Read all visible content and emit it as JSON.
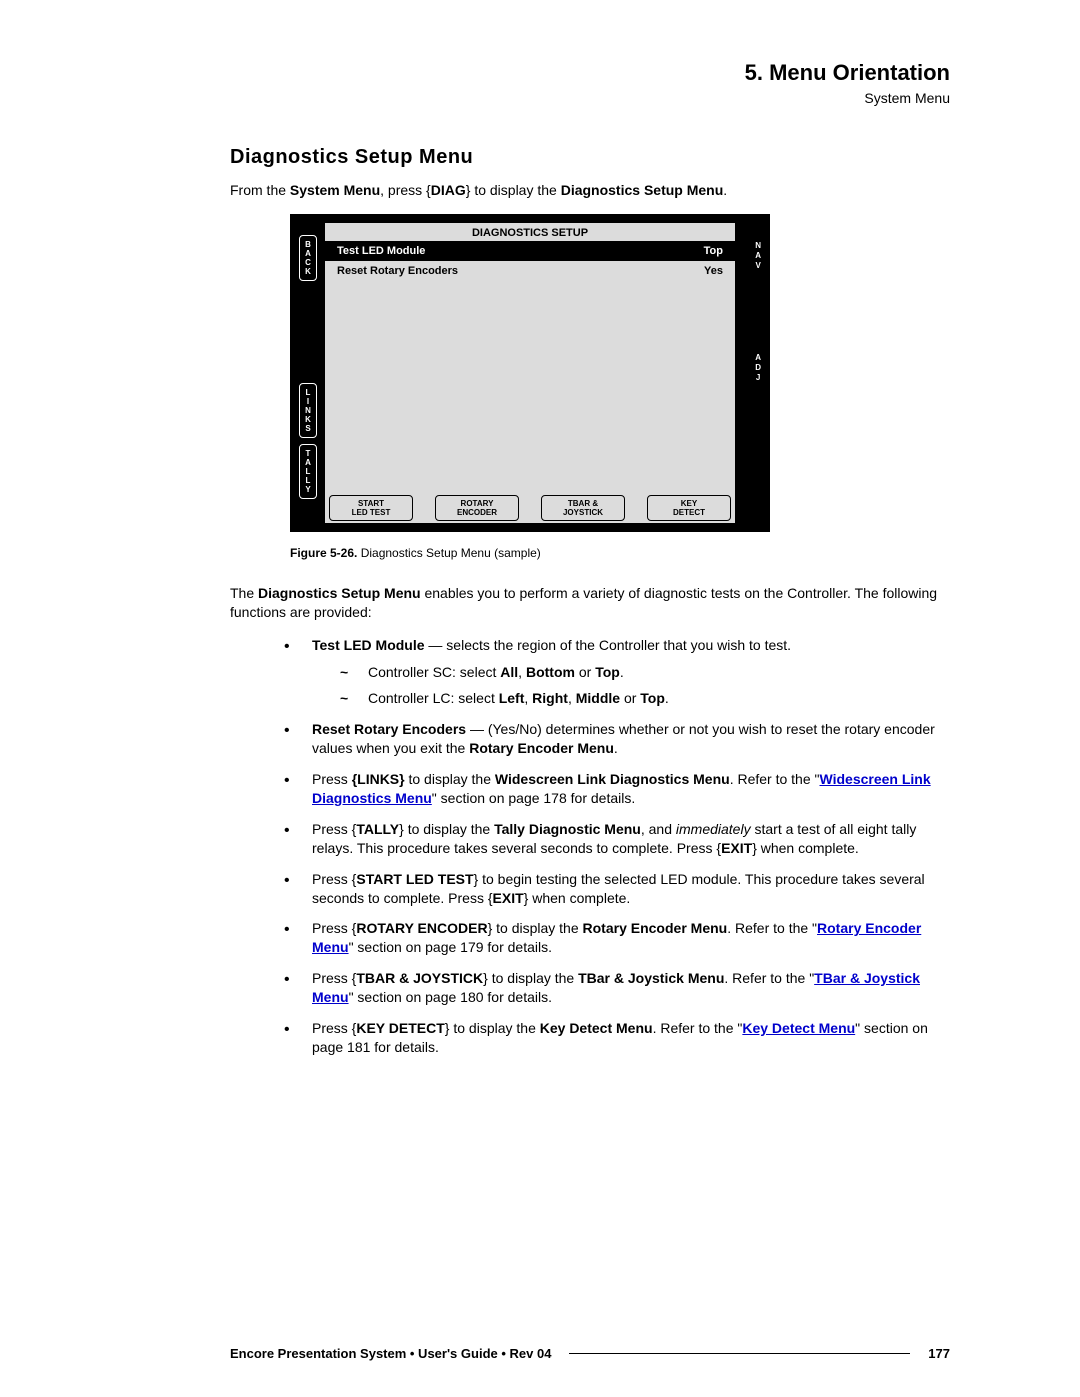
{
  "header": {
    "chapter": "5.  Menu Orientation",
    "crumb": "System Menu"
  },
  "section_title": "Diagnostics Setup Menu",
  "intro": {
    "p1": "From the ",
    "b1": "System Menu",
    "p2": ", press {",
    "b2": "DIAG",
    "p3": "} to display the ",
    "b3": "Diagnostics Setup Menu",
    "p4": "."
  },
  "device": {
    "title": "DIAGNOSTICS SETUP",
    "row1": {
      "label": "Test LED Module",
      "value": "Top"
    },
    "row2": {
      "label": "Reset Rotary Encoders",
      "value": "Yes"
    },
    "left": {
      "back": "BACK",
      "links": "LINKS",
      "tally": "TALLY"
    },
    "right": {
      "nav": "NAV",
      "adj": "ADJ"
    },
    "bottom": {
      "b1a": "START",
      "b1b": "LED TEST",
      "b2a": "ROTARY",
      "b2b": "ENCODER",
      "b3a": "TBAR &",
      "b3b": "JOYSTICK",
      "b4a": "KEY",
      "b4b": "DETECT"
    }
  },
  "figure": {
    "label_b": "Figure 5-26.",
    "label": "  Diagnostics Setup Menu  (sample)"
  },
  "desc": {
    "p1": "The ",
    "b1": "Diagnostics Setup Menu",
    "p2": " enables you to perform a variety of diagnostic tests on the Controller.  The following functions are provided:"
  },
  "bullets": {
    "b1": {
      "b": "Test LED Module",
      "t": " — selects the region of the Controller that you wish to test.",
      "s1a": "Controller SC:  select ",
      "s1b": "All",
      "s1c": ", ",
      "s1d": "Bottom",
      "s1e": " or ",
      "s1f": "Top",
      "s1g": ".",
      "s2a": "Controller LC:  select ",
      "s2b": "Left",
      "s2c": ", ",
      "s2d": "Right",
      "s2e": ", ",
      "s2f": "Middle",
      "s2g": " or ",
      "s2h": "Top",
      "s2i": "."
    },
    "b2": {
      "b": "Reset Rotary Encoders",
      "t1": " — (Yes/No) determines whether or not you wish to reset the rotary encoder values when you exit the ",
      "b2": "Rotary Encoder Menu",
      "t2": "."
    },
    "b3": {
      "t1": "Press ",
      "b1": "{LINKS}",
      "t2": " to display the ",
      "b2": "Widescreen Link Diagnostics Menu",
      "t3": ".  Refer to the \"",
      "l": "Widescreen Link Diagnostics Menu",
      "t4": "\" section on page 178 for details."
    },
    "b4": {
      "t1": "Press {",
      "b1": "TALLY",
      "t2": "} to display the ",
      "b2": "Tally Diagnostic Menu",
      "t3": ", and ",
      "i1": "immediately",
      "t4": " start a test of all eight tally relays.  This procedure takes several seconds to complete.  Press {",
      "b3": "EXIT",
      "t5": "} when complete."
    },
    "b5": {
      "t1": "Press {",
      "b1": "START LED TEST",
      "t2": "} to begin testing the selected LED module.  This procedure takes several seconds to complete.  Press {",
      "b2": "EXIT",
      "t3": "} when complete."
    },
    "b6": {
      "t1": "Press {",
      "b1": "ROTARY ENCODER",
      "t2": "} to display the ",
      "b2": "Rotary Encoder Menu",
      "t3": ".  Refer to the \"",
      "l": "Rotary Encoder Menu",
      "t4": "\" section on page 179 for details."
    },
    "b7": {
      "t1": "Press {",
      "b1": "TBAR & JOYSTICK",
      "t2": "} to display the ",
      "b2": "TBar & Joystick Menu",
      "t3": ".  Refer to the \"",
      "l": "TBar & Joystick Menu",
      "t4": "\" section on page 180 for details."
    },
    "b8": {
      "t1": "Press {",
      "b1": "KEY DETECT",
      "t2": "} to display the ",
      "b2": "Key Detect Menu",
      "t3": ".  Refer to the \"",
      "l": "Key Detect Menu",
      "t4": "\" section on page 181 for details."
    }
  },
  "footer": {
    "left": "Encore Presentation System  •  User's Guide  •  Rev 04",
    "page": "177"
  }
}
